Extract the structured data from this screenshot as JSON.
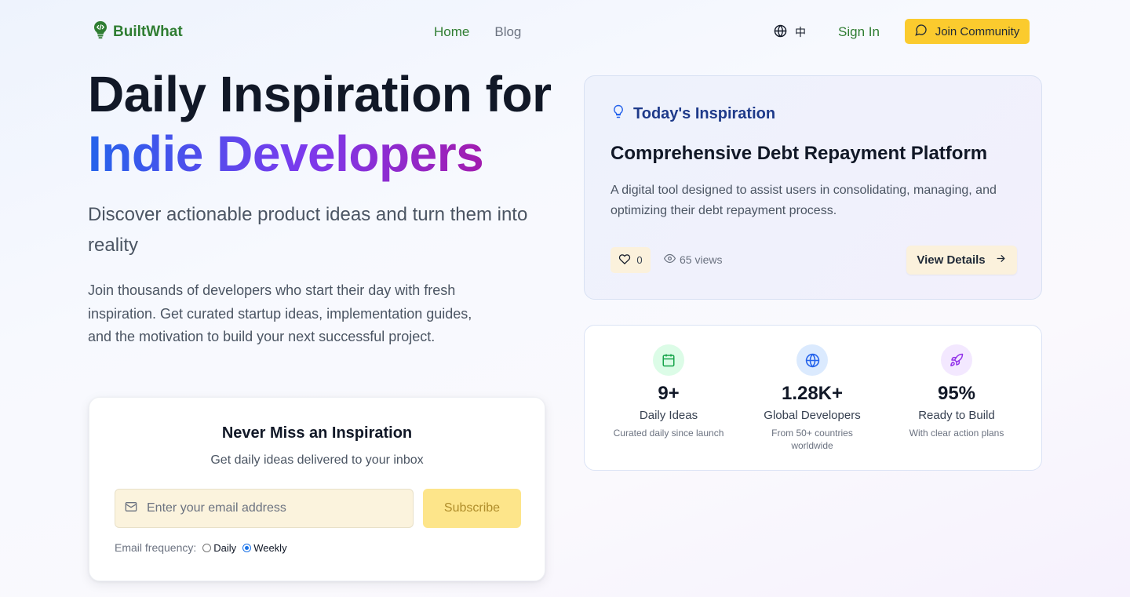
{
  "header": {
    "logo_text": "BuiltWhat",
    "nav": [
      {
        "label": "Home"
      },
      {
        "label": "Blog"
      }
    ],
    "language_label": "中",
    "sign_in_label": "Sign In",
    "join_label": "Join Community"
  },
  "hero": {
    "title_line1": "Daily Inspiration for",
    "title_line2": "Indie Developers",
    "subtitle": "Discover actionable product ideas and turn them into reality",
    "description": "Join thousands of developers who start their day with fresh inspiration. Get curated startup ideas, implementation guides, and the motivation to build your next successful project."
  },
  "newsletter": {
    "title": "Never Miss an Inspiration",
    "subtitle": "Get daily ideas delivered to your inbox",
    "email_placeholder": "Enter your email address",
    "email_value": "",
    "subscribe_label": "Subscribe",
    "frequency_label": "Email frequency:",
    "options": [
      {
        "label": "Daily",
        "selected": false
      },
      {
        "label": "Weekly",
        "selected": true
      }
    ]
  },
  "inspiration": {
    "heading": "Today's Inspiration",
    "title": "Comprehensive Debt Repayment Platform",
    "description": "A digital tool designed to assist users in consolidating, managing, and optimizing their debt repayment process.",
    "likes": "0",
    "views": "65 views",
    "view_details_label": "View Details"
  },
  "stats": [
    {
      "icon": "calendar-icon",
      "value": "9+",
      "label": "Daily Ideas",
      "note": "Curated daily since launch",
      "color": "#16a34a",
      "bg": "#dcfce7"
    },
    {
      "icon": "globe-icon",
      "value": "1.28K+",
      "label": "Global Developers",
      "note": "From 50+ countries worldwide",
      "color": "#2563eb",
      "bg": "#dbeafe"
    },
    {
      "icon": "rocket-icon",
      "value": "95%",
      "label": "Ready to Build",
      "note": "With clear action plans",
      "color": "#9333ea",
      "bg": "#f3e8ff"
    }
  ],
  "colors": {
    "brand_green": "#2f7d32",
    "accent_yellow": "#fbcb2e",
    "heading_blue": "#1e3a8a"
  }
}
